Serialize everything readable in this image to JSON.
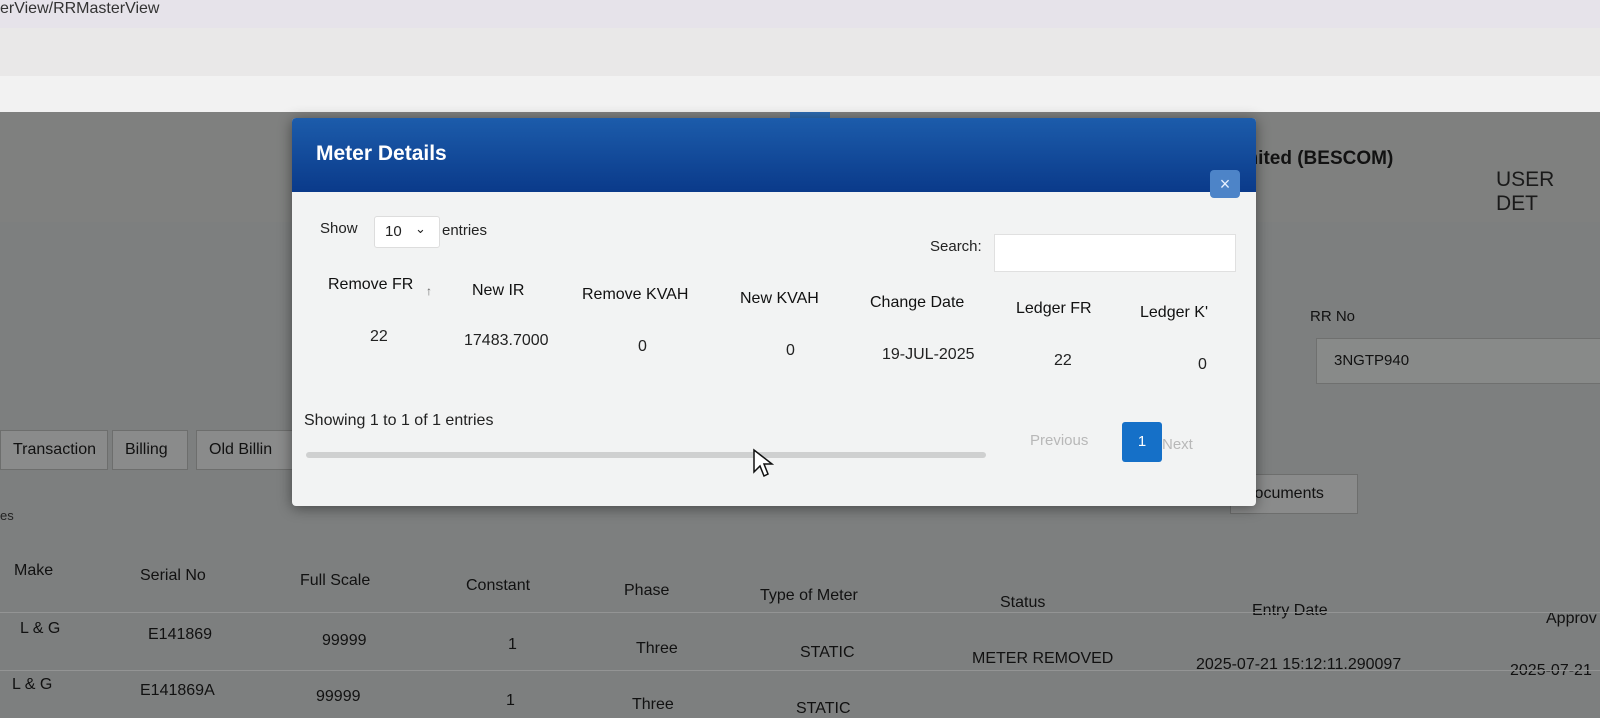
{
  "browser": {
    "url_fragment": "erView/RRMasterView"
  },
  "header": {
    "company": "imited (BESCOM)",
    "user_details": "USER DET"
  },
  "rr": {
    "label": "RR No",
    "value": "3NGTP940"
  },
  "tabs": [
    {
      "label": "Transaction"
    },
    {
      "label": "Billing"
    },
    {
      "label": "Old Billin"
    },
    {
      "label": "Documents"
    }
  ],
  "section_fragment": "es",
  "meter_table": {
    "columns": [
      "Make",
      "Serial No",
      "Full Scale",
      "Constant",
      "Phase",
      "Type of Meter",
      "Status",
      "Entry Date",
      "Approv"
    ],
    "rows": [
      [
        "L & G",
        "E141869",
        "99999",
        "1",
        "Three",
        "STATIC",
        "METER REMOVED",
        "2025-07-21 15:12:11.290097",
        "2025-07-21"
      ],
      [
        "L & G",
        "E141869A",
        "99999",
        "1",
        "Three",
        "STATIC",
        "",
        "",
        ""
      ]
    ]
  },
  "modal": {
    "title": "Meter Details",
    "close_symbol": "×",
    "show_label": "Show",
    "page_size": "10",
    "entries_label": "entries",
    "search_label": "Search:",
    "columns": [
      "Remove FR",
      "New IR",
      "Remove KVAH",
      "New KVAH",
      "Change Date",
      "Ledger FR",
      "Ledger K'"
    ],
    "rows": [
      [
        "22",
        "17483.7000",
        "0",
        "0",
        "19-JUL-2025",
        "22",
        "0"
      ]
    ],
    "info": "Showing 1 to 1 of 1 entries",
    "pagination": {
      "previous": "Previous",
      "current": "1",
      "next": "Next"
    }
  },
  "colors": {
    "modal_header": "#0a3a8a",
    "active_page": "#1570c8",
    "background": "#7d7f7f"
  }
}
